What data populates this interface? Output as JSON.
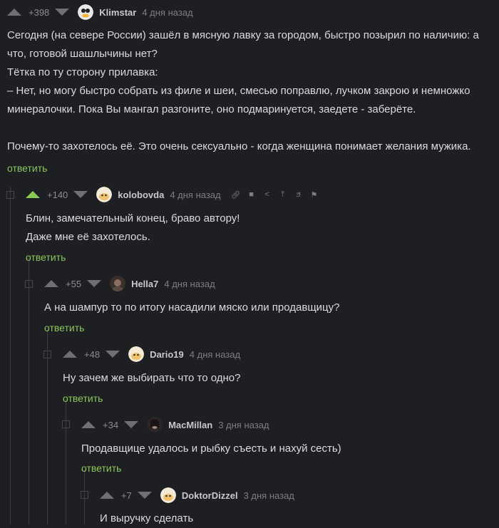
{
  "comments": [
    {
      "rating": "+398",
      "user": "Klimstar",
      "date": "4 дня назад",
      "lines": [
        "Сегодня (на севере России) зашёл в мясную лавку за городом, быстро позырил по наличию: а",
        "что, готовой шашлычины нет?",
        "Тётка по ту сторону прилавка:",
        "– Нет, но могу быстро собрать из филе и шеи, смесью поправлю, лучком закрою и немножко",
        "минералочки. Пока Вы мангал разгоните, оно подмаринуется, заедете - заберёте.",
        "",
        "Почему-то захотелось её. Это очень сексуально - когда женщина понимает желания мужика."
      ],
      "reply_label": "ответить"
    },
    {
      "rating": "+140",
      "user": "kolobovda",
      "date": "4 дня назад",
      "lines": [
        "Блин, замечательный конец, браво автору!",
        "Даже мне её захотелось."
      ],
      "reply_label": "ответить",
      "tools": [
        "link-icon",
        "save-icon",
        "share-icon",
        "pin-icon",
        "reply-branch-icon",
        "report-flag-icon"
      ]
    },
    {
      "rating": "+55",
      "user": "Hella7",
      "date": "4 дня назад",
      "lines": [
        "А на шампур то по итогу насадили мяско или продавщицу?"
      ],
      "reply_label": "ответить"
    },
    {
      "rating": "+48",
      "user": "Dario19",
      "date": "4 дня назад",
      "lines": [
        "Ну зачем же выбирать что то одно?"
      ],
      "reply_label": "ответить"
    },
    {
      "rating": "+34",
      "user": "MacMillan",
      "date": "3 дня назад",
      "lines": [
        "Продавщице удалось и рыбку съесть и нахуй сесть)"
      ],
      "reply_label": "ответить"
    },
    {
      "rating": "+7",
      "user": "DoktorDizzel",
      "date": "3 дня назад",
      "lines": [
        "И выручку сделать"
      ]
    }
  ],
  "colors": {
    "accent": "#8ac858",
    "background": "#1e1f22"
  }
}
